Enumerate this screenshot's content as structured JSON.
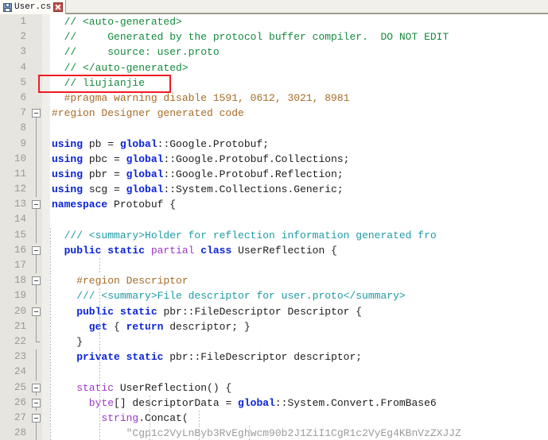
{
  "window": {
    "title": "User.cs"
  },
  "tab": {
    "label": "User.cs",
    "save_icon": "save-icon",
    "close_icon": "close-icon"
  },
  "editor": {
    "language": "csharp",
    "first_visible_line": 1,
    "last_visible_line": 28,
    "colors": {
      "comment": "#148a3c",
      "xml_doc_comment": "#1f9ba5",
      "preprocessor": "#a66c28",
      "keyword": "#0b23d8",
      "keyword_modifier": "#9b37c6",
      "string": "#9b9b9b",
      "plain_text": "#1c1c1c",
      "line_number": "#9a9890",
      "gutter_background": "#e6e5e0",
      "editor_background": "#ffffff",
      "highlight_rect": "#ee1b24"
    },
    "annotation": {
      "type": "rectangle",
      "color": "#ee1b24",
      "target_line": 5,
      "target_text": "// liujianjie"
    },
    "lines": [
      {
        "num": "1",
        "fold": "none",
        "indent_guides": [],
        "tokens": [
          {
            "text": "  // <auto-generated>",
            "cls": "t-comment"
          }
        ]
      },
      {
        "num": "2",
        "fold": "none",
        "indent_guides": [],
        "tokens": [
          {
            "text": "  //     Generated by the protocol buffer compiler.  DO NOT EDIT",
            "cls": "t-comment"
          }
        ]
      },
      {
        "num": "3",
        "fold": "none",
        "indent_guides": [],
        "tokens": [
          {
            "text": "  //     source: user.proto",
            "cls": "t-comment"
          }
        ]
      },
      {
        "num": "4",
        "fold": "none",
        "indent_guides": [],
        "tokens": [
          {
            "text": "  // </auto-generated>",
            "cls": "t-comment"
          }
        ]
      },
      {
        "num": "5",
        "fold": "none",
        "indent_guides": [],
        "tokens": [
          {
            "text": "  // liujianjie",
            "cls": "t-comment"
          }
        ]
      },
      {
        "num": "6",
        "fold": "none",
        "indent_guides": [],
        "tokens": [
          {
            "text": "  #pragma warning disable 1591, 0612, 3021, 8981",
            "cls": "t-pre"
          }
        ]
      },
      {
        "num": "7",
        "fold": "box",
        "indent_guides": [],
        "tokens": [
          {
            "text": "#region Designer generated code",
            "cls": "t-pre"
          }
        ]
      },
      {
        "num": "8",
        "fold": "line",
        "indent_guides": [],
        "tokens": [
          {
            "text": "",
            "cls": "t-plain"
          }
        ]
      },
      {
        "num": "9",
        "fold": "line",
        "indent_guides": [],
        "tokens": [
          {
            "text": "using ",
            "cls": "t-kw"
          },
          {
            "text": "pb = ",
            "cls": "t-plain"
          },
          {
            "text": "global",
            "cls": "t-kw"
          },
          {
            "text": "::Google.Protobuf;",
            "cls": "t-plain"
          }
        ]
      },
      {
        "num": "10",
        "fold": "line",
        "indent_guides": [],
        "tokens": [
          {
            "text": "using ",
            "cls": "t-kw"
          },
          {
            "text": "pbc = ",
            "cls": "t-plain"
          },
          {
            "text": "global",
            "cls": "t-kw"
          },
          {
            "text": "::Google.Protobuf.Collections;",
            "cls": "t-plain"
          }
        ]
      },
      {
        "num": "11",
        "fold": "line",
        "indent_guides": [],
        "tokens": [
          {
            "text": "using ",
            "cls": "t-kw"
          },
          {
            "text": "pbr = ",
            "cls": "t-plain"
          },
          {
            "text": "global",
            "cls": "t-kw"
          },
          {
            "text": "::Google.Protobuf.Reflection;",
            "cls": "t-plain"
          }
        ]
      },
      {
        "num": "12",
        "fold": "line",
        "indent_guides": [],
        "tokens": [
          {
            "text": "using ",
            "cls": "t-kw"
          },
          {
            "text": "scg = ",
            "cls": "t-plain"
          },
          {
            "text": "global",
            "cls": "t-kw"
          },
          {
            "text": "::System.Collections.Generic;",
            "cls": "t-plain"
          }
        ]
      },
      {
        "num": "13",
        "fold": "box",
        "indent_guides": [],
        "tokens": [
          {
            "text": "namespace ",
            "cls": "t-kw"
          },
          {
            "text": "Protobuf {",
            "cls": "t-plain"
          }
        ]
      },
      {
        "num": "14",
        "fold": "line",
        "indent_guides": [],
        "tokens": [
          {
            "text": "",
            "cls": "t-plain"
          }
        ]
      },
      {
        "num": "15",
        "fold": "line",
        "indent_guides": [
          16
        ],
        "tokens": [
          {
            "text": "  /// <summary>Holder for reflection information generated fro",
            "cls": "t-xmldoc"
          }
        ]
      },
      {
        "num": "16",
        "fold": "box",
        "indent_guides": [
          16
        ],
        "tokens": [
          {
            "text": "  public static ",
            "cls": "t-kw"
          },
          {
            "text": "partial ",
            "cls": "t-kw2"
          },
          {
            "text": "class ",
            "cls": "t-kw"
          },
          {
            "text": "UserReflection {",
            "cls": "t-plain"
          }
        ]
      },
      {
        "num": "17",
        "fold": "line",
        "indent_guides": [
          16,
          32
        ],
        "tokens": [
          {
            "text": "",
            "cls": "t-plain"
          }
        ]
      },
      {
        "num": "18",
        "fold": "box",
        "indent_guides": [
          16
        ],
        "tokens": [
          {
            "text": "    #region Descriptor",
            "cls": "t-pre"
          }
        ]
      },
      {
        "num": "19",
        "fold": "line",
        "indent_guides": [
          16,
          32
        ],
        "tokens": [
          {
            "text": "    /// <summary>File descriptor for user.proto</summary>",
            "cls": "t-xmldoc"
          }
        ]
      },
      {
        "num": "20",
        "fold": "box",
        "indent_guides": [
          16,
          32
        ],
        "tokens": [
          {
            "text": "    public static ",
            "cls": "t-kw"
          },
          {
            "text": "pbr::FileDescriptor Descriptor {",
            "cls": "t-plain"
          }
        ]
      },
      {
        "num": "21",
        "fold": "line",
        "indent_guides": [
          16,
          32,
          48
        ],
        "tokens": [
          {
            "text": "      get ",
            "cls": "t-kw"
          },
          {
            "text": "{ ",
            "cls": "t-plain"
          },
          {
            "text": "return ",
            "cls": "t-kw"
          },
          {
            "text": "descriptor; }",
            "cls": "t-plain"
          }
        ]
      },
      {
        "num": "22",
        "fold": "end",
        "indent_guides": [
          16,
          32
        ],
        "tokens": [
          {
            "text": "    }",
            "cls": "t-plain"
          }
        ]
      },
      {
        "num": "23",
        "fold": "line",
        "indent_guides": [
          16,
          32
        ],
        "tokens": [
          {
            "text": "    private static ",
            "cls": "t-kw"
          },
          {
            "text": "pbr::FileDescriptor descriptor;",
            "cls": "t-plain"
          }
        ]
      },
      {
        "num": "24",
        "fold": "line",
        "indent_guides": [
          16,
          32
        ],
        "tokens": [
          {
            "text": "",
            "cls": "t-plain"
          }
        ]
      },
      {
        "num": "25",
        "fold": "box",
        "indent_guides": [
          16,
          32
        ],
        "tokens": [
          {
            "text": "    static ",
            "cls": "t-kw2"
          },
          {
            "text": "UserReflection() {",
            "cls": "t-plain"
          }
        ]
      },
      {
        "num": "26",
        "fold": "box",
        "indent_guides": [
          16,
          32,
          48
        ],
        "tokens": [
          {
            "text": "      byte",
            "cls": "t-kw2"
          },
          {
            "text": "[] descriptorData = ",
            "cls": "t-plain"
          },
          {
            "text": "global",
            "cls": "t-kw"
          },
          {
            "text": "::System.Convert.FromBase6",
            "cls": "t-plain"
          }
        ]
      },
      {
        "num": "27",
        "fold": "box",
        "indent_guides": [
          16,
          32,
          48,
          64
        ],
        "tokens": [
          {
            "text": "        string",
            "cls": "t-kw2"
          },
          {
            "text": ".Concat(",
            "cls": "t-plain"
          }
        ]
      },
      {
        "num": "28",
        "fold": "line",
        "indent_guides": [
          16,
          32,
          48,
          64,
          80
        ],
        "tokens": [
          {
            "text": "            \"Cgp1c2VyLnByb3RvEghwcm90b2J1ZiI1CgR1c2VyEg4KBnVzZXJJZ",
            "cls": "t-str"
          }
        ]
      }
    ]
  }
}
